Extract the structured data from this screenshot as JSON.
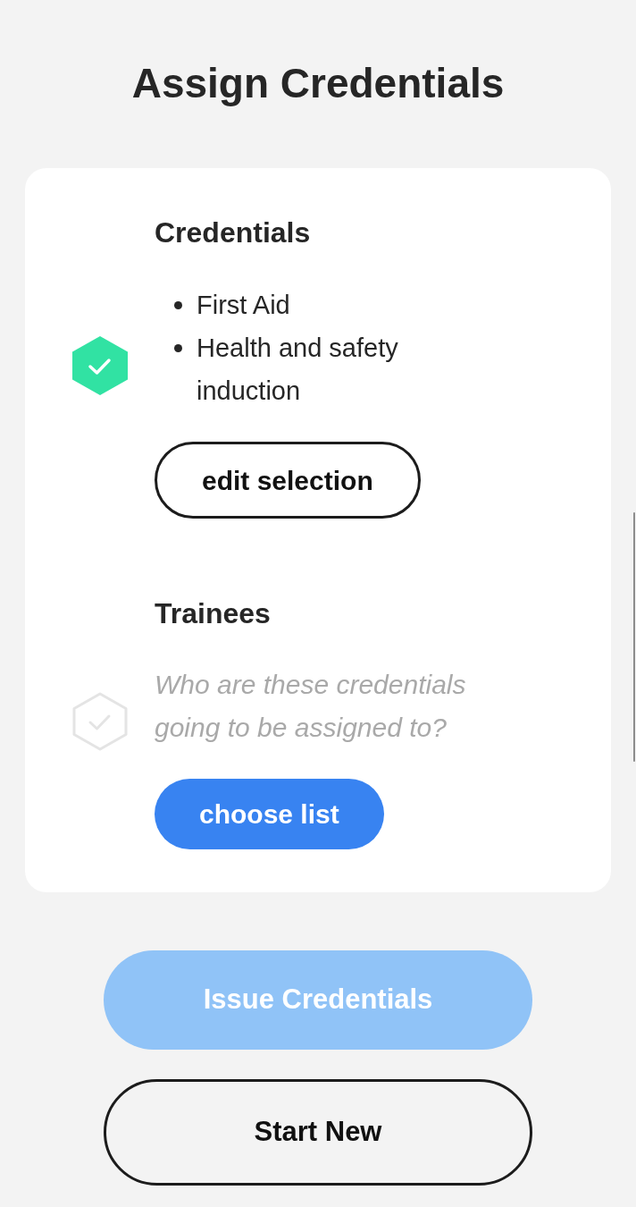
{
  "title": "Assign Credentials",
  "sections": [
    {
      "heading": "Credentials",
      "complete": true,
      "items": [
        "First Aid",
        "Health and safety induction"
      ],
      "button": {
        "label": "edit selection",
        "kind": "outline"
      }
    },
    {
      "heading": "Trainees",
      "complete": false,
      "empty_text": "Who are these credentials going to be assigned to?",
      "button": {
        "label": "choose list",
        "kind": "primary"
      }
    }
  ],
  "actions": [
    {
      "label": "Issue Credentials",
      "kind": "primary",
      "disabled": true
    },
    {
      "label": "Start New",
      "kind": "outline",
      "disabled": false
    }
  ]
}
